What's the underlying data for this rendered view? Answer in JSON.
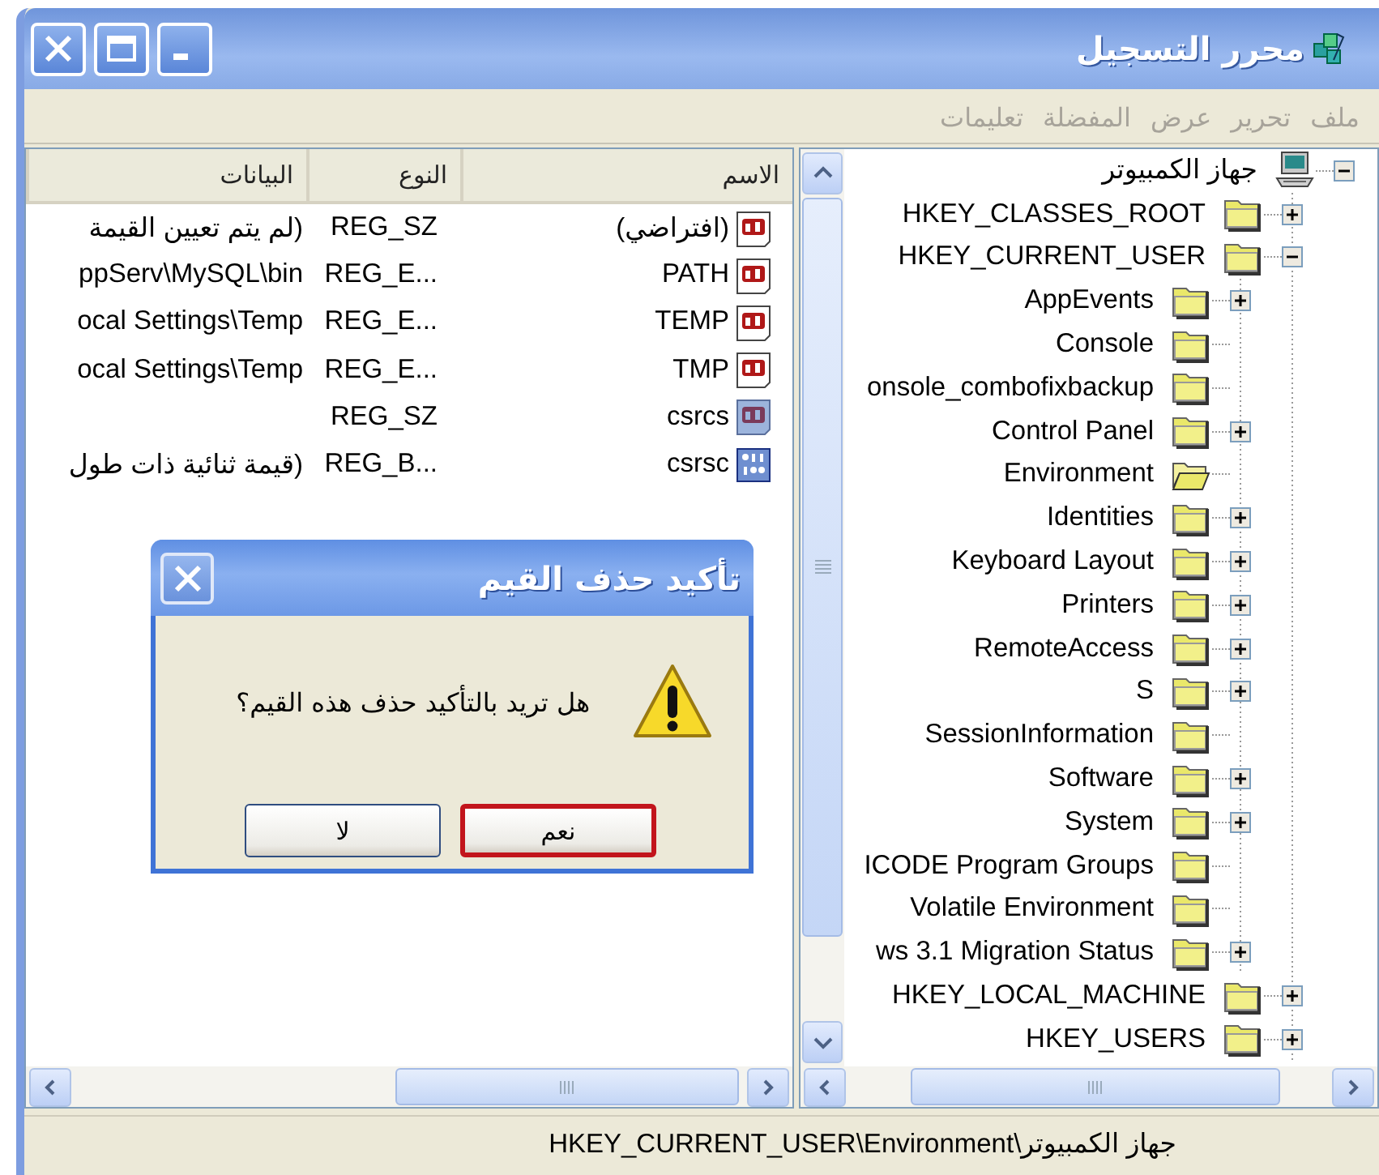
{
  "window": {
    "title": "محرر التسجيل"
  },
  "menu": [
    {
      "label": "ملف",
      "disabled": true
    },
    {
      "label": "تحرير",
      "disabled": true
    },
    {
      "label": "عرض",
      "disabled": true
    },
    {
      "label": "المفضلة",
      "disabled": true
    },
    {
      "label": "تعليمات",
      "disabled": true
    }
  ],
  "list": {
    "columns": [
      "الاسم",
      "النوع",
      "البيانات"
    ],
    "rows": [
      {
        "name": "(افتراضي)",
        "type": "REG_SZ",
        "data": "(لم يتم تعيين القيمة",
        "kind": "string",
        "selected": false
      },
      {
        "name": "PATH",
        "type": "REG_E...",
        "data": "ppServ\\MySQL\\bin",
        "kind": "string",
        "selected": false
      },
      {
        "name": "TEMP",
        "type": "REG_E...",
        "data": "ocal Settings\\Temp",
        "kind": "string",
        "selected": false
      },
      {
        "name": "TMP",
        "type": "REG_E...",
        "data": "ocal Settings\\Temp",
        "kind": "string",
        "selected": false
      },
      {
        "name": "csrcs",
        "type": "REG_SZ",
        "kind": "string",
        "selected": true
      },
      {
        "name": "csrsc",
        "type": "REG_B...",
        "data": "(قيمة ثنائية ذات طول",
        "kind": "binary",
        "selected": true
      }
    ]
  },
  "tree": {
    "label": "جهاز الكمبيوتر",
    "kind": "computer",
    "expanded": true,
    "selected": false,
    "children": [
      {
        "label": "HKEY_CLASSES_ROOT",
        "kind": "key",
        "expanded": false,
        "selected": false
      },
      {
        "label": "HKEY_CURRENT_USER",
        "kind": "key",
        "expanded": true,
        "selected": false,
        "children": [
          {
            "label": "AppEvents",
            "kind": "key",
            "expanded": false,
            "selected": false
          },
          {
            "label": "Console",
            "kind": "key",
            "selected": false
          },
          {
            "label": "onsole_combofixbackup",
            "kind": "key",
            "selected": false
          },
          {
            "label": "Control Panel",
            "kind": "key",
            "expanded": false,
            "selected": false
          },
          {
            "label": "Environment",
            "kind": "key",
            "selected": true
          },
          {
            "label": "Identities",
            "kind": "key",
            "expanded": false,
            "selected": false
          },
          {
            "label": "Keyboard Layout",
            "kind": "key",
            "expanded": false,
            "selected": false
          },
          {
            "label": "Printers",
            "kind": "key",
            "expanded": false,
            "selected": false
          },
          {
            "label": "RemoteAccess",
            "kind": "key",
            "expanded": false,
            "selected": false
          },
          {
            "label": "S",
            "kind": "key",
            "expanded": false,
            "selected": false
          },
          {
            "label": "SessionInformation",
            "kind": "key",
            "selected": false
          },
          {
            "label": "Software",
            "kind": "key",
            "expanded": false,
            "selected": false
          },
          {
            "label": "System",
            "kind": "key",
            "expanded": false,
            "selected": false
          },
          {
            "label": "ICODE Program Groups",
            "kind": "key",
            "selected": false
          },
          {
            "label": "Volatile Environment",
            "kind": "key",
            "selected": false
          },
          {
            "label": "ws 3.1 Migration Status",
            "kind": "key",
            "expanded": false,
            "selected": false
          }
        ]
      },
      {
        "label": "HKEY_LOCAL_MACHINE",
        "kind": "key",
        "expanded": false,
        "selected": false
      },
      {
        "label": "HKEY_USERS",
        "kind": "key",
        "expanded": false,
        "selected": false
      }
    ]
  },
  "status_bar": "جهاز الكمبيوتر\\HKEY_CURRENT_USER\\Environment",
  "dialog": {
    "title": "تأكيد حذف القيم",
    "message": "هل تريد بالتأكيد حذف هذه القيم؟",
    "buttons": [
      {
        "label": "نعم",
        "focused": true
      },
      {
        "label": "لا",
        "focused": false
      }
    ]
  }
}
